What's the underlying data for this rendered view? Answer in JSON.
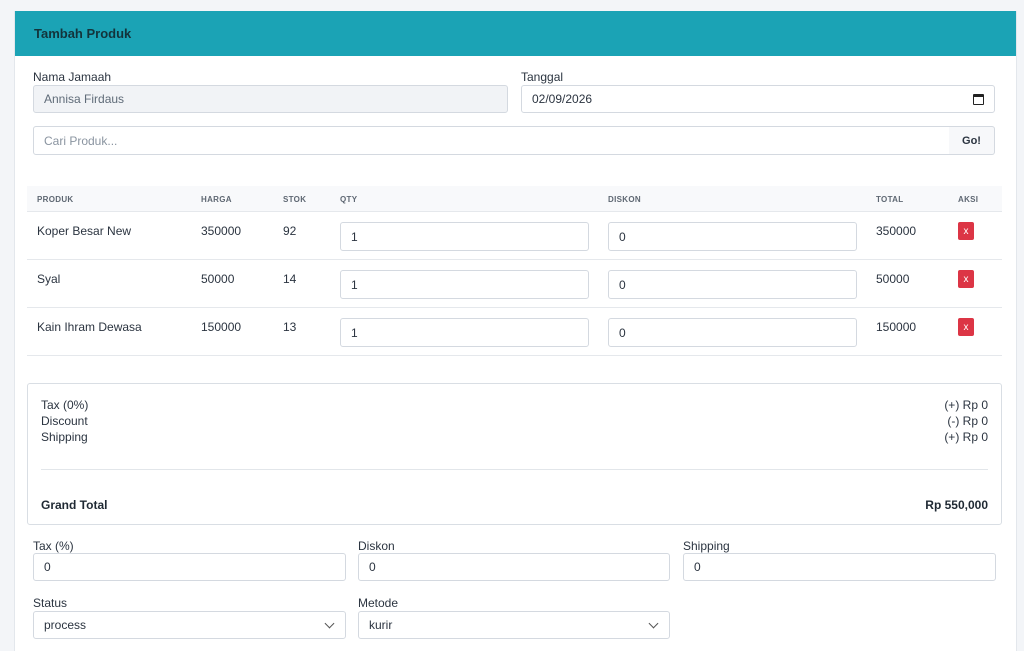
{
  "header": {
    "title": "Tambah Produk"
  },
  "form": {
    "nama_label": "Nama Jamaah",
    "nama_value": "Annisa Firdaus",
    "tanggal_label": "Tanggal",
    "tanggal_value": "02/09/2026",
    "search_placeholder": "Cari Produk...",
    "go_label": "Go!"
  },
  "table": {
    "headers": [
      "PRODUK",
      "HARGA",
      "STOK",
      "QTY",
      "DISKON",
      "TOTAL",
      "AKSI"
    ],
    "rows": [
      {
        "produk": "Koper Besar New",
        "harga": "350000",
        "stok": "92",
        "qty": "1",
        "diskon": "0",
        "total": "350000",
        "aksi": "x"
      },
      {
        "produk": "Syal",
        "harga": "50000",
        "stok": "14",
        "qty": "1",
        "diskon": "0",
        "total": "50000",
        "aksi": "x"
      },
      {
        "produk": "Kain Ihram Dewasa",
        "harga": "150000",
        "stok": "13",
        "qty": "1",
        "diskon": "0",
        "total": "150000",
        "aksi": "x"
      }
    ]
  },
  "summary": {
    "tax_label": "Tax (0%)",
    "tax_value": "(+) Rp 0",
    "discount_label": "Discount",
    "discount_value": "(-) Rp 0",
    "shipping_label": "Shipping",
    "shipping_value": "(+) Rp 0",
    "grand_label": "Grand Total",
    "grand_value": "Rp 550,000"
  },
  "bottom": {
    "tax_label": "Tax (%)",
    "tax_value": "0",
    "diskon_label": "Diskon",
    "diskon_value": "0",
    "shipping_label": "Shipping",
    "shipping_value": "0",
    "status_label": "Status",
    "status_value": "process",
    "metode_label": "Metode",
    "metode_value": "kurir"
  },
  "colors": {
    "header_bg": "#1ba3b5",
    "delete_btn": "#dc3545"
  }
}
